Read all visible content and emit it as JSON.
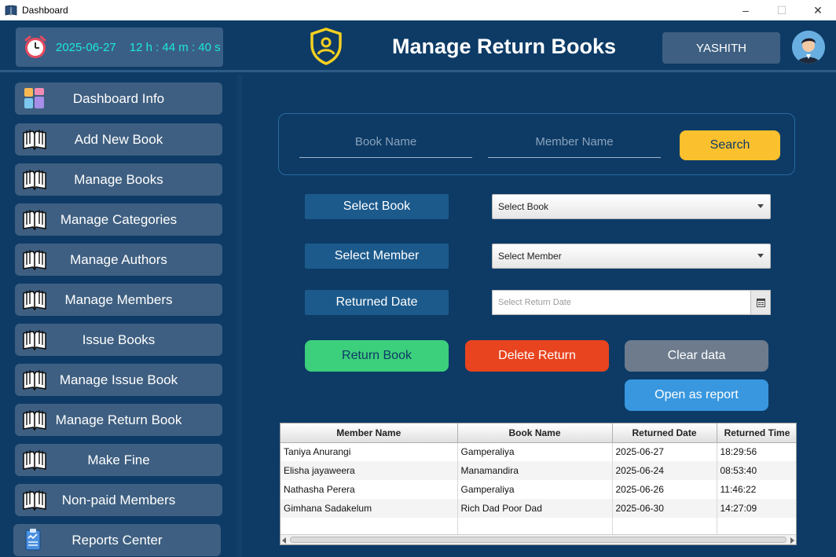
{
  "window": {
    "title": "Dashboard",
    "minimize_glyph": "–",
    "maximize_glyph": "☐",
    "close_glyph": "✕"
  },
  "header": {
    "date": "2025-06-27",
    "time": "12 h : 44 m : 40 s",
    "page_title": "Manage Return Books",
    "username": "YASHITH"
  },
  "sidebar": {
    "items": [
      {
        "label": "Dashboard Info",
        "icon": "dashboard-grid-icon"
      },
      {
        "label": "Add New Book",
        "icon": "book-icon"
      },
      {
        "label": "Manage Books",
        "icon": "book-icon"
      },
      {
        "label": "Manage Categories",
        "icon": "book-icon"
      },
      {
        "label": "Manage Authors",
        "icon": "book-icon"
      },
      {
        "label": "Manage Members",
        "icon": "book-icon"
      },
      {
        "label": "Issue Books",
        "icon": "book-icon"
      },
      {
        "label": "Manage Issue Book",
        "icon": "book-icon"
      },
      {
        "label": "Manage Return Book",
        "icon": "book-icon"
      },
      {
        "label": "Make Fine",
        "icon": "book-icon"
      },
      {
        "label": "Non-paid Members",
        "icon": "book-icon"
      },
      {
        "label": "Reports Center",
        "icon": "clipboard-report-icon"
      }
    ]
  },
  "search": {
    "book_name_placeholder": "Book Name",
    "member_name_placeholder": "Member Name",
    "search_label": "Search"
  },
  "form": {
    "select_book_label": "Select Book",
    "select_book_value": "Select Book",
    "select_member_label": "Select Member",
    "select_member_value": "Select Member",
    "returned_date_label": "Returned Date",
    "returned_date_placeholder": "Select Return Date"
  },
  "actions": {
    "return_book": "Return Book",
    "delete_return": "Delete Return",
    "clear_data": "Clear data",
    "open_report": "Open as report"
  },
  "colors": {
    "background": "#0d3b66",
    "return_button": "#3ccf7c",
    "delete_button": "#e8441f",
    "clear_button": "#6d7b8d",
    "report_button": "#3897df",
    "search_button": "#fbc02d",
    "clock_text": "#1de9d6"
  },
  "table": {
    "headers": [
      "Member Name",
      "Book Name",
      "Returned Date",
      "Returned Time"
    ],
    "rows": [
      [
        "Taniya Anurangi",
        "Gamperaliya",
        "2025-06-27",
        "18:29:56"
      ],
      [
        "Elisha jayaweera",
        "Manamandira",
        "2025-06-24",
        "08:53:40"
      ],
      [
        "Nathasha Perera",
        "Gamperaliya",
        "2025-06-26",
        "11:46:22"
      ],
      [
        "Gimhana Sadakelum",
        "Rich Dad Poor Dad",
        "2025-06-30",
        "14:27:09"
      ]
    ]
  }
}
